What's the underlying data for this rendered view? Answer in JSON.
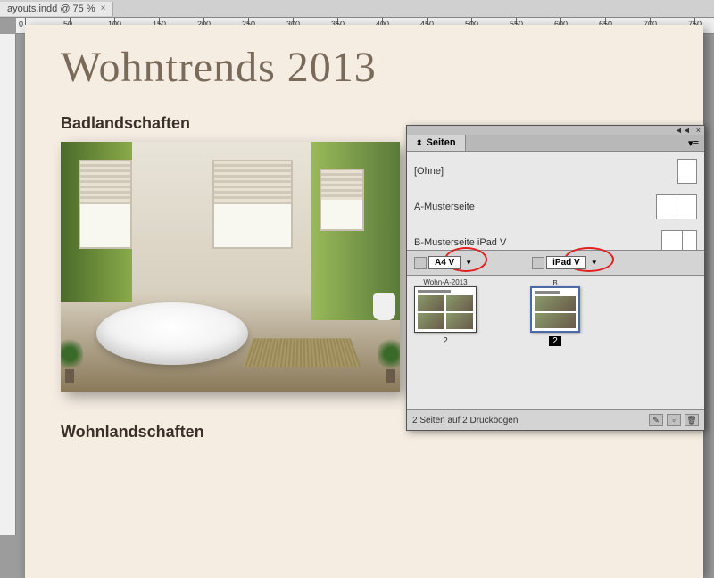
{
  "document_tab": "ayouts.indd @ 75 %",
  "ruler_marks": [
    "0",
    "50",
    "100",
    "150",
    "200",
    "250",
    "300",
    "350",
    "400",
    "450",
    "500",
    "550",
    "600",
    "650",
    "700",
    "750"
  ],
  "page": {
    "title": "Wohntrends 2013",
    "section1": "Badlandschaften",
    "section2": "Wohnlandschaften"
  },
  "panel": {
    "title": "Seiten",
    "masters": [
      {
        "label": "[Ohne]",
        "type": "single"
      },
      {
        "label": "A-Musterseite",
        "type": "double"
      },
      {
        "label": "B-Musterseite iPad V",
        "type": "ipad"
      }
    ],
    "layouts": [
      {
        "name": "A4 V",
        "page_label": "2",
        "thumb_header": "Wohn-A-2013",
        "master_letter": "A"
      },
      {
        "name": "iPad V",
        "page_label": "2",
        "master_letter": "B"
      }
    ],
    "footer_status": "2 Seiten auf 2 Druckbögen"
  }
}
